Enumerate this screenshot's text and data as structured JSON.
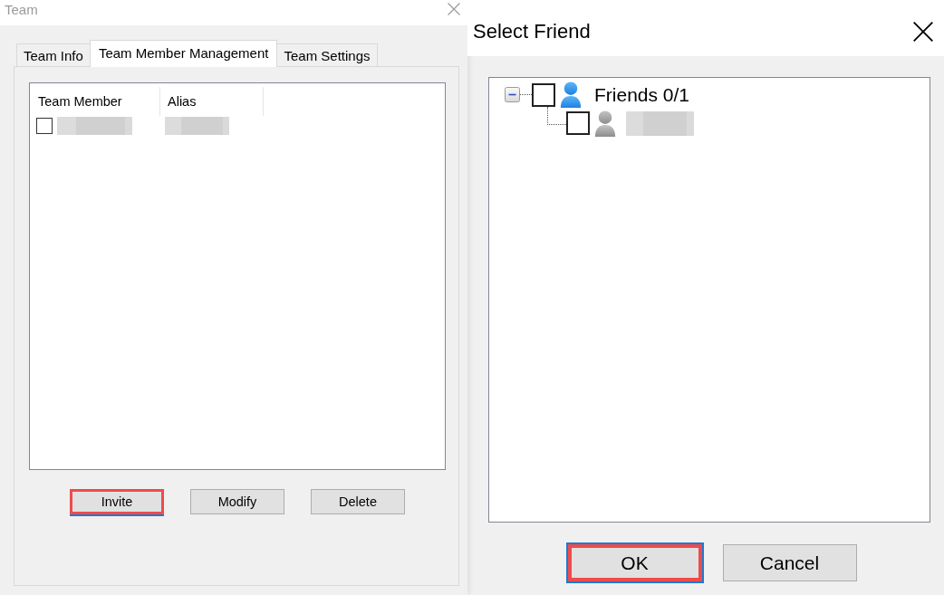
{
  "team_window": {
    "title": "Team",
    "active": false,
    "tabs": [
      {
        "label": "Team Info",
        "selected": false
      },
      {
        "label": "Team Member Management",
        "selected": true
      },
      {
        "label": "Team Settings",
        "selected": false
      }
    ],
    "member_table": {
      "columns": [
        "Team Member",
        "Alias"
      ],
      "rows": [
        {
          "checked": false,
          "member_redacted": true,
          "alias_redacted": true
        }
      ]
    },
    "buttons": [
      {
        "label": "Invite",
        "highlighted": true
      },
      {
        "label": "Modify",
        "highlighted": false
      },
      {
        "label": "Delete",
        "highlighted": false
      }
    ]
  },
  "select_friend_window": {
    "title": "Select Friend",
    "active": true,
    "tree": [
      {
        "kind": "group",
        "label": "Friends 0/1",
        "checked": false,
        "expanded": true,
        "children": [
          {
            "kind": "friend",
            "checked": false,
            "name_redacted": true
          }
        ]
      }
    ],
    "buttons": [
      {
        "label": "OK",
        "highlighted": true
      },
      {
        "label": "Cancel",
        "highlighted": false
      }
    ]
  }
}
